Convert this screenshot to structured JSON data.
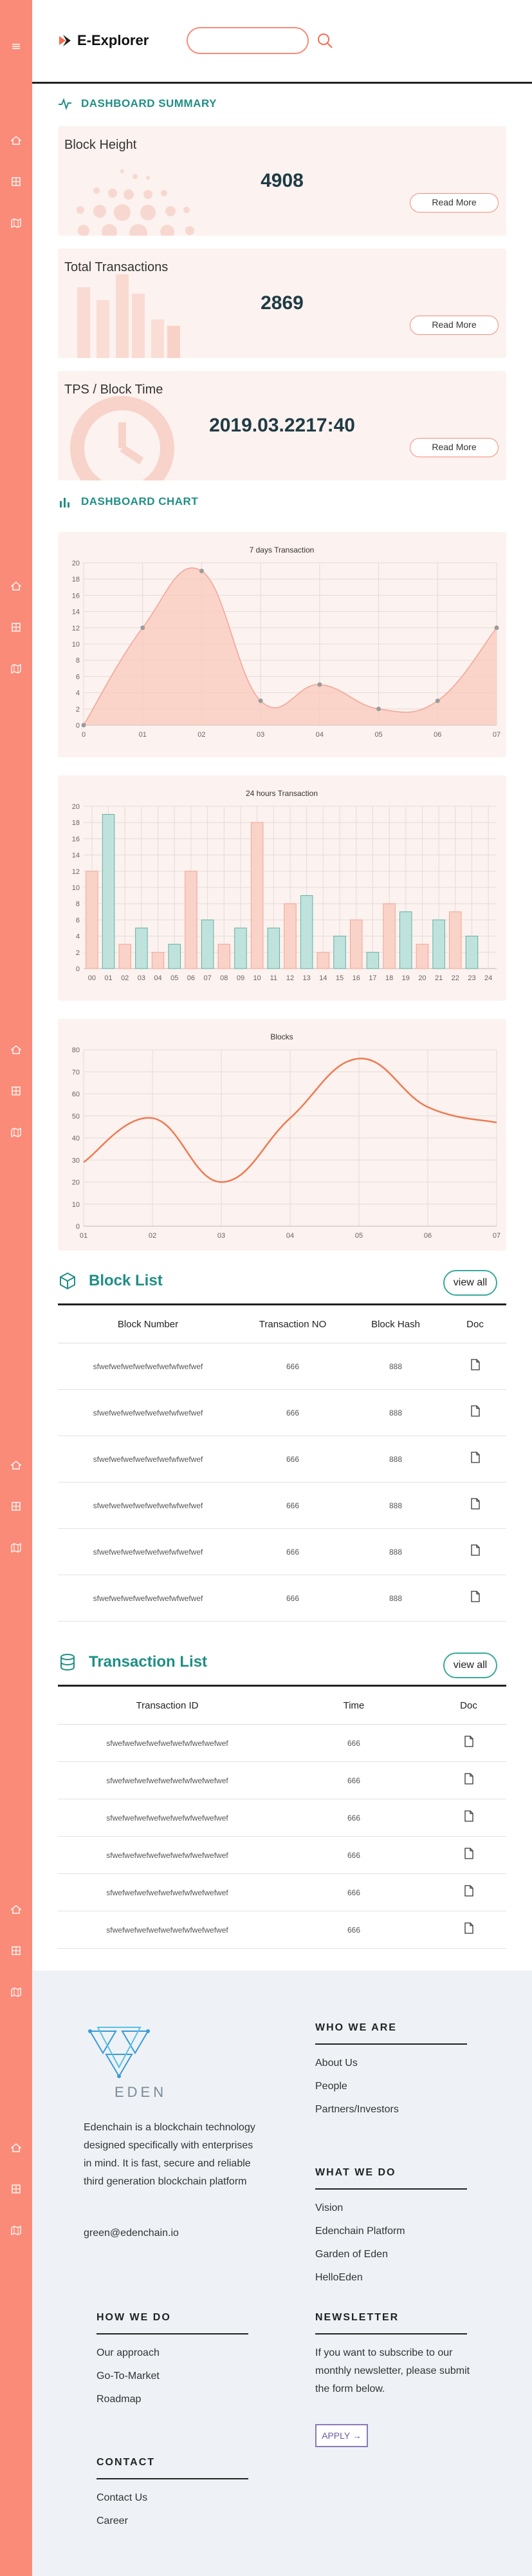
{
  "app": {
    "name": "E-Explorer"
  },
  "search": {
    "placeholder": ""
  },
  "summary": {
    "heading": "DASHBOARD SUMMARY",
    "cards": [
      {
        "title": "Block Height",
        "value": "4908",
        "button": "Read More"
      },
      {
        "title": "Total Transactions",
        "value": "2869",
        "button": "Read More"
      },
      {
        "title": "TPS / Block Time",
        "value": "2019.03.2217:40",
        "button": "Read More"
      }
    ]
  },
  "dashboard_chart": {
    "heading": "DASHBOARD CHART"
  },
  "chart_data": [
    {
      "type": "area",
      "title": "7 days Transaction",
      "x": [
        "0",
        "01",
        "02",
        "03",
        "04",
        "05",
        "06",
        "07"
      ],
      "values": [
        0,
        12,
        19,
        3,
        5,
        2,
        3,
        12
      ],
      "ylim": [
        0,
        20
      ],
      "yticks": [
        0,
        2,
        4,
        6,
        8,
        10,
        12,
        14,
        16,
        18,
        20
      ],
      "grid": true,
      "colors": {
        "fill": "#f9cbbf",
        "line": "#f2a594",
        "point": "#9b9b9b"
      }
    },
    {
      "type": "bar",
      "title": "24 hours Transaction",
      "categories": [
        "00",
        "01",
        "02",
        "03",
        "04",
        "05",
        "06",
        "07",
        "08",
        "09",
        "10",
        "11",
        "12",
        "13",
        "14",
        "15",
        "16",
        "17",
        "18",
        "19",
        "20",
        "21",
        "22",
        "23",
        "24"
      ],
      "values": [
        12,
        19,
        3,
        5,
        2,
        3,
        12,
        6,
        3,
        5,
        18,
        5,
        8,
        9,
        2,
        4,
        6,
        2,
        8,
        7,
        3,
        6,
        7,
        4,
        0
      ],
      "ylim": [
        0,
        20
      ],
      "yticks": [
        0,
        2,
        4,
        6,
        8,
        10,
        12,
        14,
        16,
        18,
        20
      ],
      "grid": true,
      "colors": {
        "pink": "#f9d2c8",
        "pink_border": "#f2a594",
        "teal": "#bfe3dc",
        "teal_border": "#5fb0a4"
      }
    },
    {
      "type": "line",
      "title": "Blocks",
      "x": [
        "01",
        "02",
        "03",
        "04",
        "05",
        "06",
        "07"
      ],
      "values": [
        29,
        49,
        20,
        49,
        76,
        54,
        47
      ],
      "ylim": [
        0,
        80
      ],
      "yticks": [
        0,
        10,
        20,
        30,
        40,
        50,
        60,
        70,
        80
      ],
      "grid": true,
      "colors": {
        "line": "#ee7a52"
      }
    }
  ],
  "block_list": {
    "title": "Block List",
    "view_all": "view all",
    "columns": [
      "Block Number",
      "Transaction NO",
      "Block Hash",
      "Doc"
    ],
    "rows": [
      {
        "number": "sfwefwefwefwefwefwefwfwefwef",
        "tx": "666",
        "hash": "888"
      },
      {
        "number": "sfwefwefwefwefwefwefwfwefwef",
        "tx": "666",
        "hash": "888"
      },
      {
        "number": "sfwefwefwefwefwefwefwfwefwef",
        "tx": "666",
        "hash": "888"
      },
      {
        "number": "sfwefwefwefwefwefwefwfwefwef",
        "tx": "666",
        "hash": "888"
      },
      {
        "number": "sfwefwefwefwefwefwefwfwefwef",
        "tx": "666",
        "hash": "888"
      },
      {
        "number": "sfwefwefwefwefwefwefwfwefwef",
        "tx": "666",
        "hash": "888"
      }
    ]
  },
  "transaction_list": {
    "title": "Transaction List",
    "view_all": "view all",
    "columns": [
      "Transaction ID",
      "Time",
      "Doc"
    ],
    "rows": [
      {
        "id": "sfwefwefwefwefwefwefwfwefwefwef",
        "time": "666"
      },
      {
        "id": "sfwefwefwefwefwefwefwfwefwefwef",
        "time": "666"
      },
      {
        "id": "sfwefwefwefwefwefwefwfwefwefwef",
        "time": "666"
      },
      {
        "id": "sfwefwefwefwefwefwefwfwefwefwef",
        "time": "666"
      },
      {
        "id": "sfwefwefwefwefwefwefwfwefwefwef",
        "time": "666"
      },
      {
        "id": "sfwefwefwefwefwefwefwfwefwefwef",
        "time": "666"
      }
    ]
  },
  "footer": {
    "brand": "EDEN",
    "about": "Edenchain is a blockchain technology designed specifically with enterprises in mind. It is fast, secure and reliable third generation blockchain platform",
    "email": "green@edenchain.io",
    "who_we_are": {
      "title": "WHO WE ARE",
      "links": [
        "About Us",
        "People",
        "Partners/Investors"
      ]
    },
    "what_we_do": {
      "title": "WHAT WE DO",
      "links": [
        "Vision",
        "Edenchain Platform",
        "Garden of Eden",
        "HelloEden"
      ]
    },
    "how_we_do": {
      "title": "HOW WE DO",
      "links": [
        "Our approach",
        "Go-To-Market",
        "Roadmap"
      ]
    },
    "newsletter": {
      "title": "NEWSLETTER",
      "text": "If you want to subscribe to our monthly newsletter, please submit the form below.",
      "button": "APPLY →"
    },
    "contact": {
      "title": "CONTACT",
      "links": [
        "Contact Us",
        "Career"
      ]
    }
  }
}
